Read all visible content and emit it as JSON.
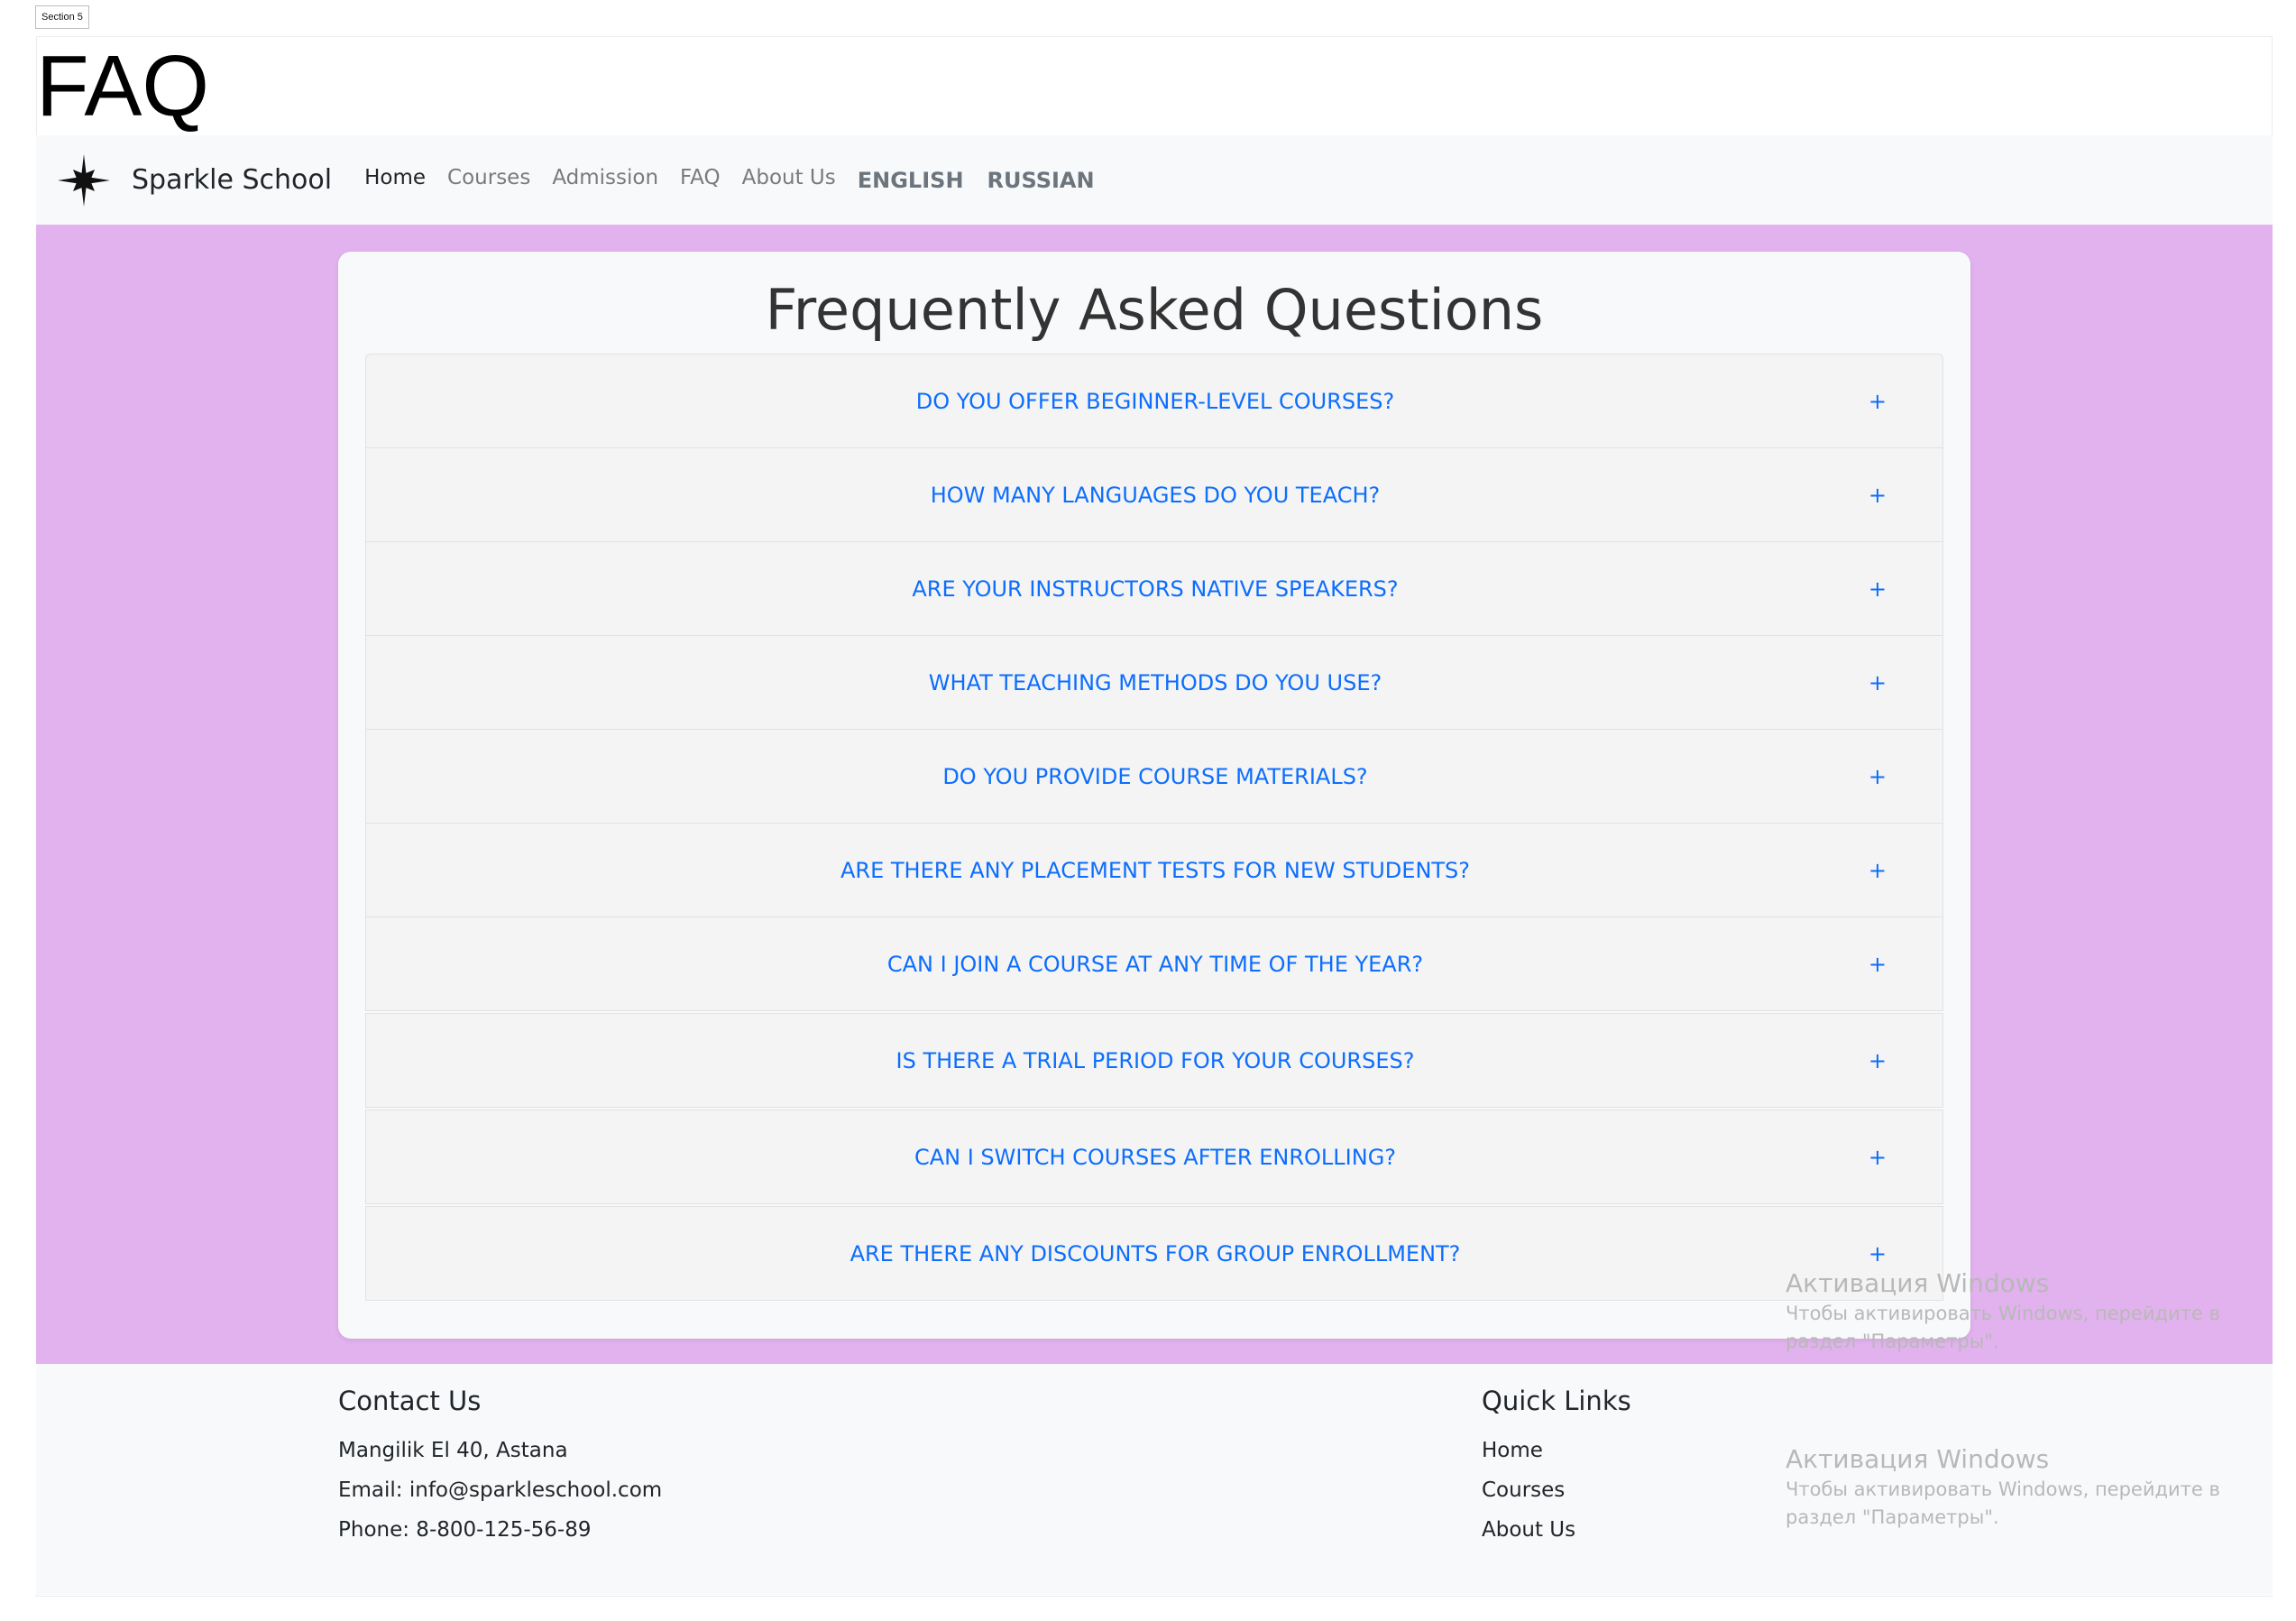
{
  "section_tag": "Section 5",
  "page_heading": "FAQ",
  "navbar": {
    "brand": "Sparkle School",
    "links": [
      "Home",
      "Courses",
      "Admission",
      "FAQ",
      "About Us"
    ],
    "languages": [
      "ENGLISH",
      "RUSSIAN"
    ]
  },
  "faq": {
    "title": "Frequently Asked Questions",
    "toggle_symbol": "+",
    "items": [
      "DO YOU OFFER BEGINNER-LEVEL COURSES?",
      "HOW MANY LANGUAGES DO YOU TEACH?",
      "ARE YOUR INSTRUCTORS NATIVE SPEAKERS?",
      "WHAT TEACHING METHODS DO YOU USE?",
      "DO YOU PROVIDE COURSE MATERIALS?",
      "ARE THERE ANY PLACEMENT TESTS FOR NEW STUDENTS?",
      "CAN I JOIN A COURSE AT ANY TIME OF THE YEAR?",
      "IS THERE A TRIAL PERIOD FOR YOUR COURSES?",
      "CAN I SWITCH COURSES AFTER ENROLLING?",
      "ARE THERE ANY DISCOUNTS FOR GROUP ENROLLMENT?"
    ]
  },
  "footer": {
    "contact": {
      "heading": "Contact Us",
      "address": "Mangilik El 40, Astana",
      "email": "Email: info@sparkleschool.com",
      "phone": "Phone: 8-800-125-56-89"
    },
    "quick_links": {
      "heading": "Quick Links",
      "links": [
        "Home",
        "Courses",
        "About Us"
      ]
    }
  },
  "watermark": {
    "title": "Активация Windows",
    "text": "Чтобы активировать Windows, перейдите в раздел \"Параметры\"."
  },
  "colors": {
    "hero_background": "#e2b2ee",
    "link_blue": "#0d6efd"
  }
}
